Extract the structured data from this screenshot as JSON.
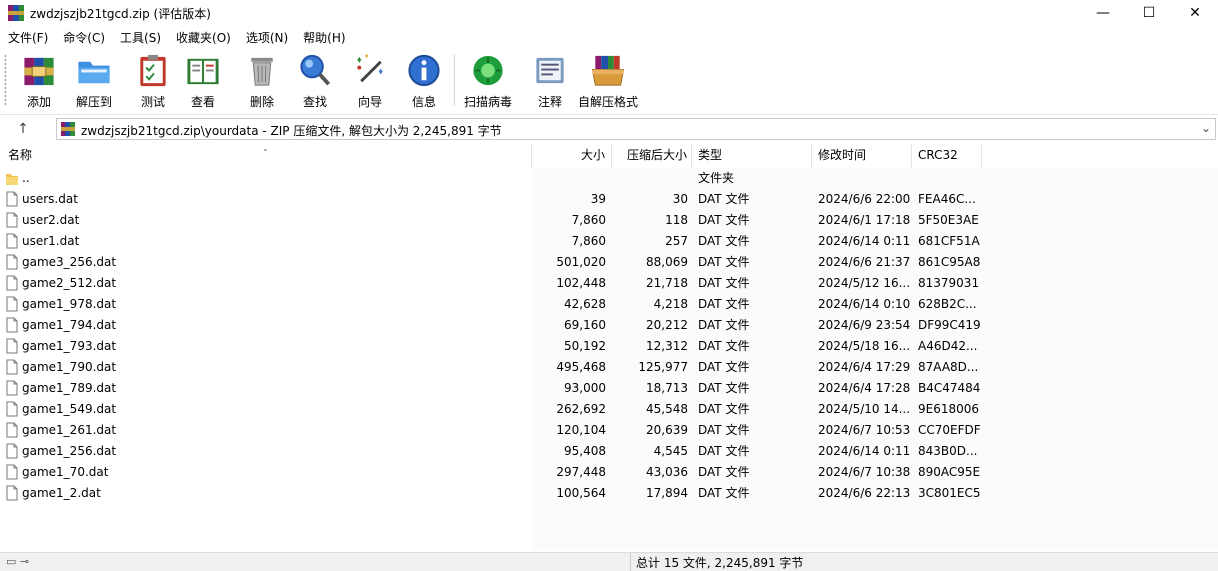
{
  "window": {
    "title": "zwdzjszjb21tgcd.zip (评估版本)",
    "minimize": "—",
    "maximize": "☐",
    "close": "✕"
  },
  "menu": [
    "文件(F)",
    "命令(C)",
    "工具(S)",
    "收藏夹(O)",
    "选项(N)",
    "帮助(H)"
  ],
  "toolbar": {
    "add": "添加",
    "extract": "解压到",
    "test": "测试",
    "view": "查看",
    "delete": "删除",
    "find": "查找",
    "wizard": "向导",
    "info": "信息",
    "virus_scan": "扫描病毒",
    "comment": "注释",
    "sfx": "自解压格式"
  },
  "address": {
    "path": "zwdzjszjb21tgcd.zip\\yourdata - ZIP 压缩文件, 解包大小为 2,245,891 字节"
  },
  "columns": {
    "name": "名称",
    "size": "大小",
    "packed": "压缩后大小",
    "type": "类型",
    "modified": "修改时间",
    "crc": "CRC32"
  },
  "rows": [
    {
      "name": "..",
      "size": "",
      "packed": "",
      "type": "文件夹",
      "modified": "",
      "crc": "",
      "folder": true
    },
    {
      "name": "users.dat",
      "size": "39",
      "packed": "30",
      "type": "DAT 文件",
      "modified": "2024/6/6 22:00",
      "crc": "FEA46C..."
    },
    {
      "name": "user2.dat",
      "size": "7,860",
      "packed": "118",
      "type": "DAT 文件",
      "modified": "2024/6/1 17:18",
      "crc": "5F50E3AE"
    },
    {
      "name": "user1.dat",
      "size": "7,860",
      "packed": "257",
      "type": "DAT 文件",
      "modified": "2024/6/14 0:11",
      "crc": "681CF51A"
    },
    {
      "name": "game3_256.dat",
      "size": "501,020",
      "packed": "88,069",
      "type": "DAT 文件",
      "modified": "2024/6/6 21:37",
      "crc": "861C95A8"
    },
    {
      "name": "game2_512.dat",
      "size": "102,448",
      "packed": "21,718",
      "type": "DAT 文件",
      "modified": "2024/5/12 16...",
      "crc": "81379031"
    },
    {
      "name": "game1_978.dat",
      "size": "42,628",
      "packed": "4,218",
      "type": "DAT 文件",
      "modified": "2024/6/14 0:10",
      "crc": "628B2C..."
    },
    {
      "name": "game1_794.dat",
      "size": "69,160",
      "packed": "20,212",
      "type": "DAT 文件",
      "modified": "2024/6/9 23:54",
      "crc": "DF99C419"
    },
    {
      "name": "game1_793.dat",
      "size": "50,192",
      "packed": "12,312",
      "type": "DAT 文件",
      "modified": "2024/5/18 16...",
      "crc": "A46D42..."
    },
    {
      "name": "game1_790.dat",
      "size": "495,468",
      "packed": "125,977",
      "type": "DAT 文件",
      "modified": "2024/6/4 17:29",
      "crc": "87AA8D..."
    },
    {
      "name": "game1_789.dat",
      "size": "93,000",
      "packed": "18,713",
      "type": "DAT 文件",
      "modified": "2024/6/4 17:28",
      "crc": "B4C47484"
    },
    {
      "name": "game1_549.dat",
      "size": "262,692",
      "packed": "45,548",
      "type": "DAT 文件",
      "modified": "2024/5/10 14...",
      "crc": "9E618006"
    },
    {
      "name": "game1_261.dat",
      "size": "120,104",
      "packed": "20,639",
      "type": "DAT 文件",
      "modified": "2024/6/7 10:53",
      "crc": "CC70EFDF"
    },
    {
      "name": "game1_256.dat",
      "size": "95,408",
      "packed": "4,545",
      "type": "DAT 文件",
      "modified": "2024/6/14 0:11",
      "crc": "843B0D..."
    },
    {
      "name": "game1_70.dat",
      "size": "297,448",
      "packed": "43,036",
      "type": "DAT 文件",
      "modified": "2024/6/7 10:38",
      "crc": "890AC95E"
    },
    {
      "name": "game1_2.dat",
      "size": "100,564",
      "packed": "17,894",
      "type": "DAT 文件",
      "modified": "2024/6/6 22:13",
      "crc": "3C801EC5"
    }
  ],
  "status": {
    "summary": "总计 15 文件, 2,245,891 字节"
  }
}
